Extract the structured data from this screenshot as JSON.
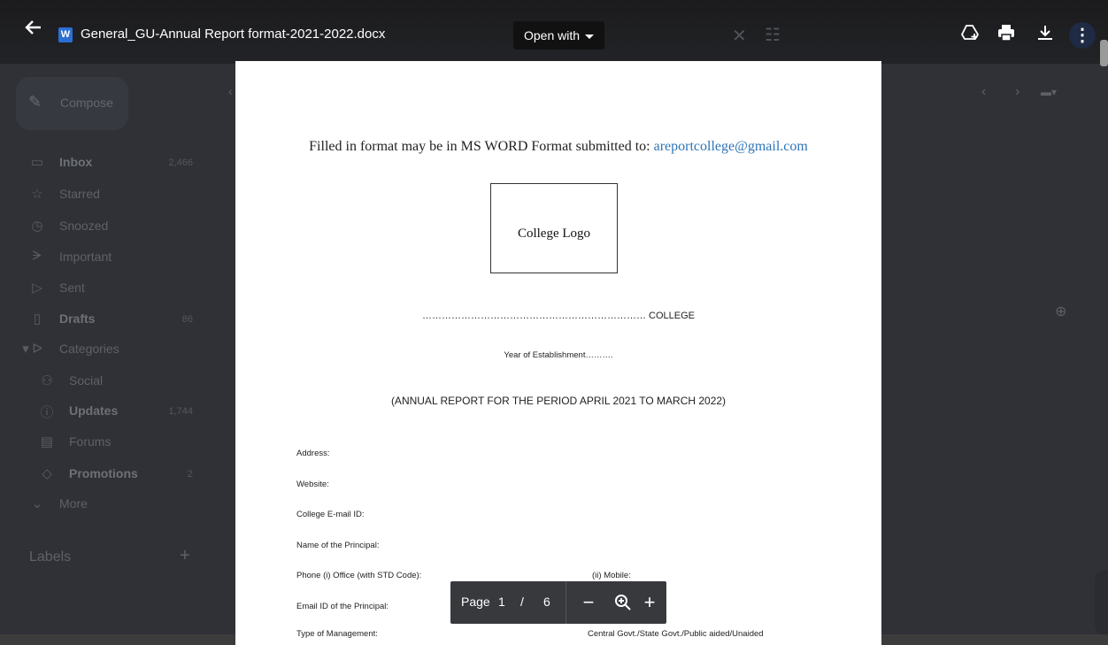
{
  "toolbar": {
    "file_title": "General_GU-Annual Report format-2021-2022.docx",
    "file_type_badge": "W",
    "open_with_label": "Open with"
  },
  "background": {
    "compose_label": "Compose",
    "nav_items": [
      {
        "label": "Inbox",
        "count": "2,466",
        "bold": true
      },
      {
        "label": "Starred",
        "count": ""
      },
      {
        "label": "Snoozed",
        "count": ""
      },
      {
        "label": "Important",
        "count": ""
      },
      {
        "label": "Sent",
        "count": ""
      },
      {
        "label": "Drafts",
        "count": "86",
        "bold": true
      },
      {
        "label": "Categories",
        "count": ""
      },
      {
        "label": "Social",
        "count": ""
      },
      {
        "label": "Updates",
        "count": "1,744",
        "bold": true
      },
      {
        "label": "Forums",
        "count": ""
      },
      {
        "label": "Promotions",
        "count": "2",
        "bold": true
      },
      {
        "label": "More",
        "count": ""
      }
    ],
    "labels_heading": "Labels",
    "labels_add": "+"
  },
  "document": {
    "instruction_prefix": "Filled in format may be in MS WORD Format submitted to: ",
    "instruction_email": "areportcollege@gmail.com",
    "logo_placeholder": "College Logo",
    "college_line": "…………………………………………………………… COLLEGE",
    "year_line": "Year of Establishment……….",
    "period_line": "(ANNUAL REPORT FOR THE PERIOD APRIL 2021 TO MARCH 2022)",
    "fields": [
      "Address:",
      "Website:",
      "College E-mail ID:",
      "Name of the Principal:",
      "Phone (i) Office (with STD Code):",
      "Email ID of the Principal:",
      "Type of Management:"
    ],
    "mobile_label": "(ii) Mobile:",
    "management_options": "Central Govt./State Govt./Public aided/Unaided"
  },
  "pager": {
    "page_label": "Page",
    "current_page": "1",
    "separator": "/",
    "total_pages": "6",
    "zoom_out": "−",
    "zoom_in": "+"
  }
}
